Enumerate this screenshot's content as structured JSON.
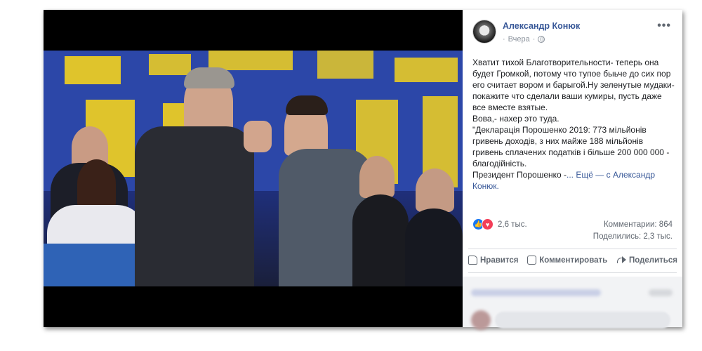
{
  "post": {
    "author": "Александр Конюк",
    "time": "Вчера",
    "text_lines": [
      "Хватит тихой Благотворительности- теперь она будет Громкой, потому что тупое быьче до сих пор его считает вором и барыгой.Ну зеленутые мудаки-покажите что сделали ваши кумиры, пусть даже все вместе взятые.",
      "Вова,- нахер это туда.",
      "\"Декларація Порошенко 2019: 773 мільйонів гривень доходів, з них майже 188 мільйонів гривень сплачених податків і більше 200 000 000 - благодійність.",
      "Президент Порошенко -"
    ],
    "ellipsis": "...",
    "more_label": "Ещё",
    "with_label": "— с",
    "tagged": "Александр Конюк."
  },
  "stats": {
    "reactions": "2,6 тыс.",
    "comments": "Комментарии: 864",
    "shares": "Поделились: 2,3 тыс."
  },
  "actions": {
    "like": "Нравится",
    "comment": "Комментировать",
    "share": "Поделиться"
  },
  "icons": {
    "like_reaction": "thumbs-up-icon",
    "love_reaction": "heart-icon",
    "audience": "globe-icon",
    "menu": "more-options-icon"
  },
  "colors": {
    "link": "#385898",
    "like": "#1877f2",
    "love": "#f33e58"
  }
}
